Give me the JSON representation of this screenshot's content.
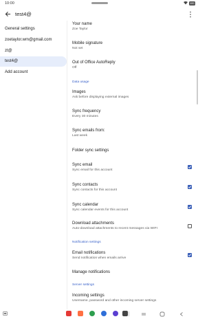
{
  "status_bar": {
    "time": "10:00",
    "battery": "100"
  },
  "app_bar": {
    "title": "test4@"
  },
  "accounts": [
    {
      "label": "General settings",
      "selected": false
    },
    {
      "label": "zoetaylor.wm@gmail.com",
      "selected": false
    },
    {
      "label": "zt@",
      "selected": false
    },
    {
      "label": "test4@",
      "selected": true
    },
    {
      "label": "Add account",
      "selected": false
    }
  ],
  "settings": {
    "your_name": {
      "title": "Your name",
      "value": "Zoe Taylor"
    },
    "mobile_signature": {
      "title": "Mobile signature",
      "value": "Not set"
    },
    "out_of_office": {
      "title": "Out of Office AutoReply",
      "value": "Off"
    },
    "section_data_usage": "Data usage",
    "images": {
      "title": "Images",
      "value": "Ask before displaying external images"
    },
    "sync_frequency": {
      "title": "Sync frequency",
      "value": "Every 30 minutes"
    },
    "sync_emails_from": {
      "title": "Sync emails from:",
      "value": "Last week"
    },
    "folder_sync": {
      "title": "Folder sync settings"
    },
    "sync_email": {
      "title": "Sync email",
      "value": "Sync email for this account",
      "checked": true
    },
    "sync_contacts": {
      "title": "Sync contacts",
      "value": "Sync contacts for this account",
      "checked": true
    },
    "sync_calendar": {
      "title": "Sync calendar",
      "value": "Sync calendar events for this account",
      "checked": true
    },
    "download_attachments": {
      "title": "Download attachments",
      "value": "Auto-download attachments to recent messages via WIFI",
      "checked": false
    },
    "section_notification": "Notification settings",
    "email_notifications": {
      "title": "Email notifications",
      "value": "Send notification when emails arrive",
      "checked": true
    },
    "manage_notifications": {
      "title": "Manage notifications"
    },
    "section_server": "Server settings",
    "incoming_settings": {
      "title": "Incoming settings",
      "value": "Username, password and other incoming server settings"
    }
  },
  "colors": {
    "accent": "#3a5fb8",
    "selected_bg": "#e6edfb",
    "section_header": "#3a62c9"
  },
  "dock_apps": [
    {
      "name": "app-red-icon",
      "color": "#e53935"
    },
    {
      "name": "app-orange-icon",
      "color": "#ff7043"
    },
    {
      "name": "app-green-icon",
      "color": "#2e9e4f"
    },
    {
      "name": "app-blue-chat-icon",
      "color": "#2f6fd8"
    },
    {
      "name": "app-purple-icon",
      "color": "#5b3fd1"
    },
    {
      "name": "camera-icon",
      "color": "#444444"
    }
  ]
}
